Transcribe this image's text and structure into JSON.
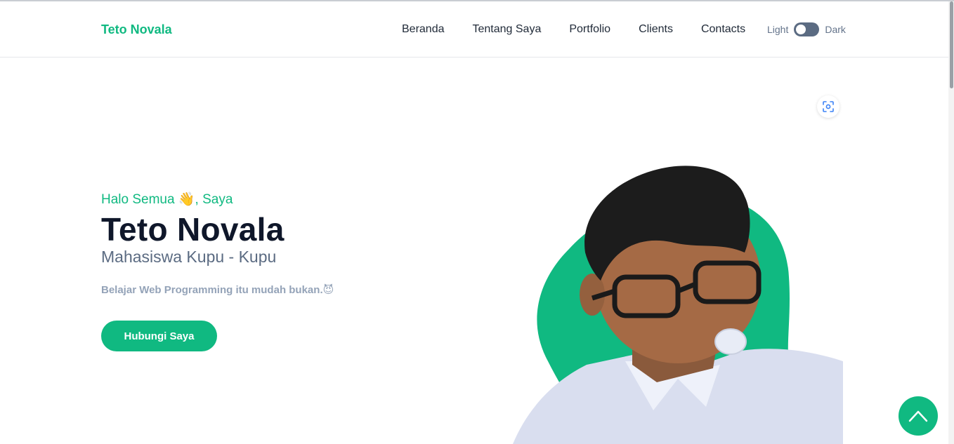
{
  "header": {
    "brand": "Teto Novala",
    "nav": [
      "Beranda",
      "Tentang Saya",
      "Portfolio",
      "Clients",
      "Contacts"
    ],
    "theme_toggle": {
      "light_label": "Light",
      "dark_label": "Dark"
    }
  },
  "hero": {
    "greeting_prefix": "Halo Semua ",
    "greeting_emoji": "👋",
    "greeting_suffix": ", Saya",
    "name": "Teto Novala",
    "role": "Mahasiswa Kupu - Kupu",
    "tagline": "Belajar Web Programming itu mudah bukan.",
    "tagline_emoji": "😈",
    "cta_label": "Hubungi Saya"
  },
  "colors": {
    "accent": "#10b981",
    "heading": "#0f172a",
    "muted": "#5b6b82",
    "light_muted": "#94a3b8"
  },
  "icons": {
    "scan": "scan-focus-icon",
    "back_to_top": "chevron-up-icon"
  }
}
